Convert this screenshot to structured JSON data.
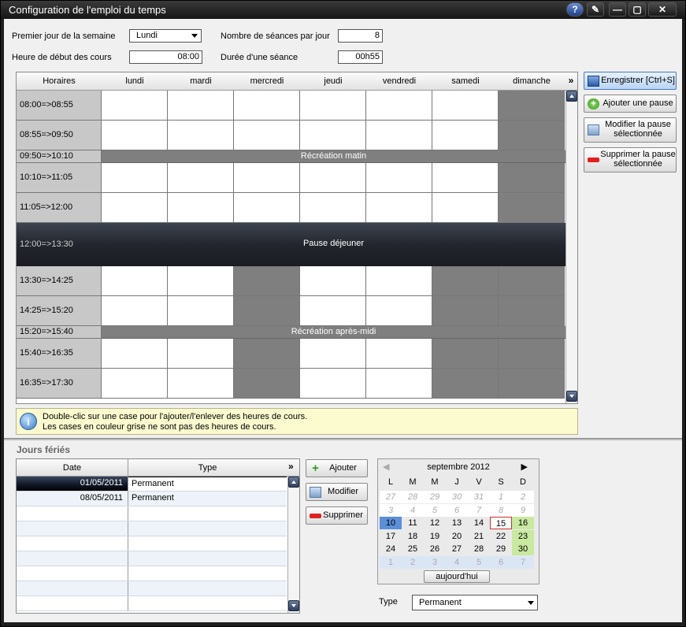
{
  "window": {
    "title": "Configuration de l'emploi du temps",
    "buttons": [
      "?",
      "✎",
      "—",
      "▢",
      "✕"
    ]
  },
  "settings": {
    "first_day_label": "Premier jour de la semaine",
    "first_day_value": "Lundi",
    "sessions_label": "Nombre de séances par jour",
    "sessions_value": "8",
    "start_label": "Heure de début des cours",
    "start_value": "08:00",
    "duration_label": "Durée d'une séance",
    "duration_value": "00h55"
  },
  "grid": {
    "time_header": "Horaires",
    "days": [
      "lundi",
      "mardi",
      "mercredi",
      "jeudi",
      "vendredi",
      "samedi",
      "dimanche"
    ],
    "rows": [
      {
        "kind": "slot",
        "time": "08:00=>08:55",
        "gray": [
          false,
          false,
          false,
          false,
          false,
          false,
          true
        ]
      },
      {
        "kind": "slot",
        "time": "08:55=>09:50",
        "gray": [
          false,
          false,
          false,
          false,
          false,
          false,
          true
        ]
      },
      {
        "kind": "pause",
        "time": "09:50=>10:10",
        "label": "Récréation matin"
      },
      {
        "kind": "slot",
        "time": "10:10=>11:05",
        "gray": [
          false,
          false,
          false,
          false,
          false,
          false,
          true
        ]
      },
      {
        "kind": "slot",
        "time": "11:05=>12:00",
        "gray": [
          false,
          false,
          false,
          false,
          false,
          false,
          true
        ]
      },
      {
        "kind": "lunch",
        "time": "12:00=>13:30",
        "label": "Pause déjeuner"
      },
      {
        "kind": "slot",
        "time": "13:30=>14:25",
        "gray": [
          false,
          false,
          true,
          false,
          false,
          true,
          true
        ]
      },
      {
        "kind": "slot",
        "time": "14:25=>15:20",
        "gray": [
          false,
          false,
          true,
          false,
          false,
          true,
          true
        ]
      },
      {
        "kind": "pause",
        "time": "15:20=>15:40",
        "label": "Récréation après-midi"
      },
      {
        "kind": "slot",
        "time": "15:40=>16:35",
        "gray": [
          false,
          false,
          true,
          false,
          false,
          true,
          true
        ]
      },
      {
        "kind": "slot",
        "time": "16:35=>17:30",
        "gray": [
          false,
          false,
          true,
          false,
          false,
          true,
          true
        ]
      }
    ]
  },
  "actions": {
    "save": "Enregistrer [Ctrl+S]",
    "add_pause": "Ajouter une pause",
    "edit_pause": [
      "Modifier la pause",
      "sélectionnée"
    ],
    "delete_pause": [
      "Supprimer la pause",
      "sélectionnée"
    ]
  },
  "info": {
    "line1": "Double-clic sur une case pour l'ajouter/l'enlever des heures de cours.",
    "line2": "Les cases en couleur grise ne sont pas des heures de cours."
  },
  "holidays": {
    "title": "Jours fériés",
    "col_date": "Date",
    "col_type": "Type",
    "rows": [
      {
        "date": "01/05/2011",
        "type": "Permanent"
      },
      {
        "date": "08/05/2011",
        "type": "Permanent"
      }
    ],
    "add": "Ajouter",
    "edit": "Modifier",
    "delete": "Supprimer",
    "type_label": "Type",
    "type_value": "Permanent"
  },
  "calendar": {
    "month": "septembre 2012",
    "dow": [
      "L",
      "M",
      "M",
      "J",
      "V",
      "S",
      "D"
    ],
    "weeks": [
      [
        "27",
        "28",
        "29",
        "30",
        "31",
        "1",
        "2"
      ],
      [
        "3",
        "4",
        "5",
        "6",
        "7",
        "8",
        "9"
      ],
      [
        "10",
        "11",
        "12",
        "13",
        "14",
        "15",
        "16"
      ],
      [
        "17",
        "18",
        "19",
        "20",
        "21",
        "22",
        "23"
      ],
      [
        "24",
        "25",
        "26",
        "27",
        "28",
        "29",
        "30"
      ],
      [
        "1",
        "2",
        "3",
        "4",
        "5",
        "6",
        "7"
      ]
    ],
    "today_button": "aujourd'hui",
    "colors": {
      "selected": "#5b8fd9",
      "today_border": "#d03030",
      "weekend_hi": "#c9e8a0",
      "week_last": "#dbe6f5"
    }
  }
}
